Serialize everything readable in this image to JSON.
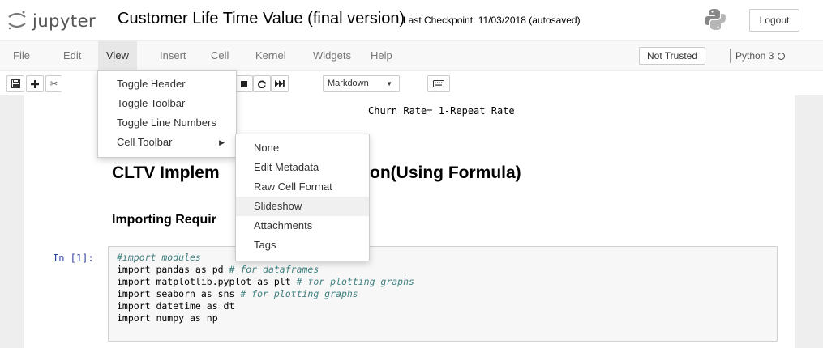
{
  "header": {
    "logo_text": "jupyter",
    "notebook_title": "Customer Life Time Value (final version)",
    "checkpoint": "Last Checkpoint: 11/03/2018  (autosaved)",
    "logout_label": "Logout"
  },
  "menubar": {
    "items": [
      "File",
      "Edit",
      "View",
      "Insert",
      "Cell",
      "Kernel",
      "Widgets",
      "Help"
    ],
    "active": "View",
    "trust_label": "Not Trusted",
    "kernel_name": "Python 3"
  },
  "toolbar": {
    "partial_label": "n",
    "cell_type": "Markdown"
  },
  "view_menu": {
    "items": [
      "Toggle Header",
      "Toggle Toolbar",
      "Toggle Line Numbers",
      "Cell Toolbar"
    ]
  },
  "cell_toolbar_submenu": {
    "items": [
      "None",
      "Edit Metadata",
      "Raw Cell Format",
      "Slideshow",
      "Attachments",
      "Tags"
    ],
    "highlighted": "Slideshow"
  },
  "notebook": {
    "churn_line": "Churn Rate= 1-Repeat Rate",
    "heading_clv_left": "CLTV Implem",
    "heading_clv_right": "on(Using Formula)",
    "heading_import": "Importing Requir",
    "prompt": "In [1]:",
    "code": [
      {
        "code": "",
        "comment": "#import modules"
      },
      {
        "code": "import pandas as pd ",
        "comment": "# for dataframes"
      },
      {
        "code": "import matplotlib.pyplot as plt ",
        "comment": "# for plotting graphs"
      },
      {
        "code": "import seaborn as sns ",
        "comment": "# for plotting graphs"
      },
      {
        "code": "import datetime as dt",
        "comment": ""
      },
      {
        "code": "import numpy as np",
        "comment": ""
      }
    ]
  },
  "colors": {
    "prompt": "#303f9f",
    "comment": "#408080",
    "menubar_bg": "#f8f8f8"
  }
}
